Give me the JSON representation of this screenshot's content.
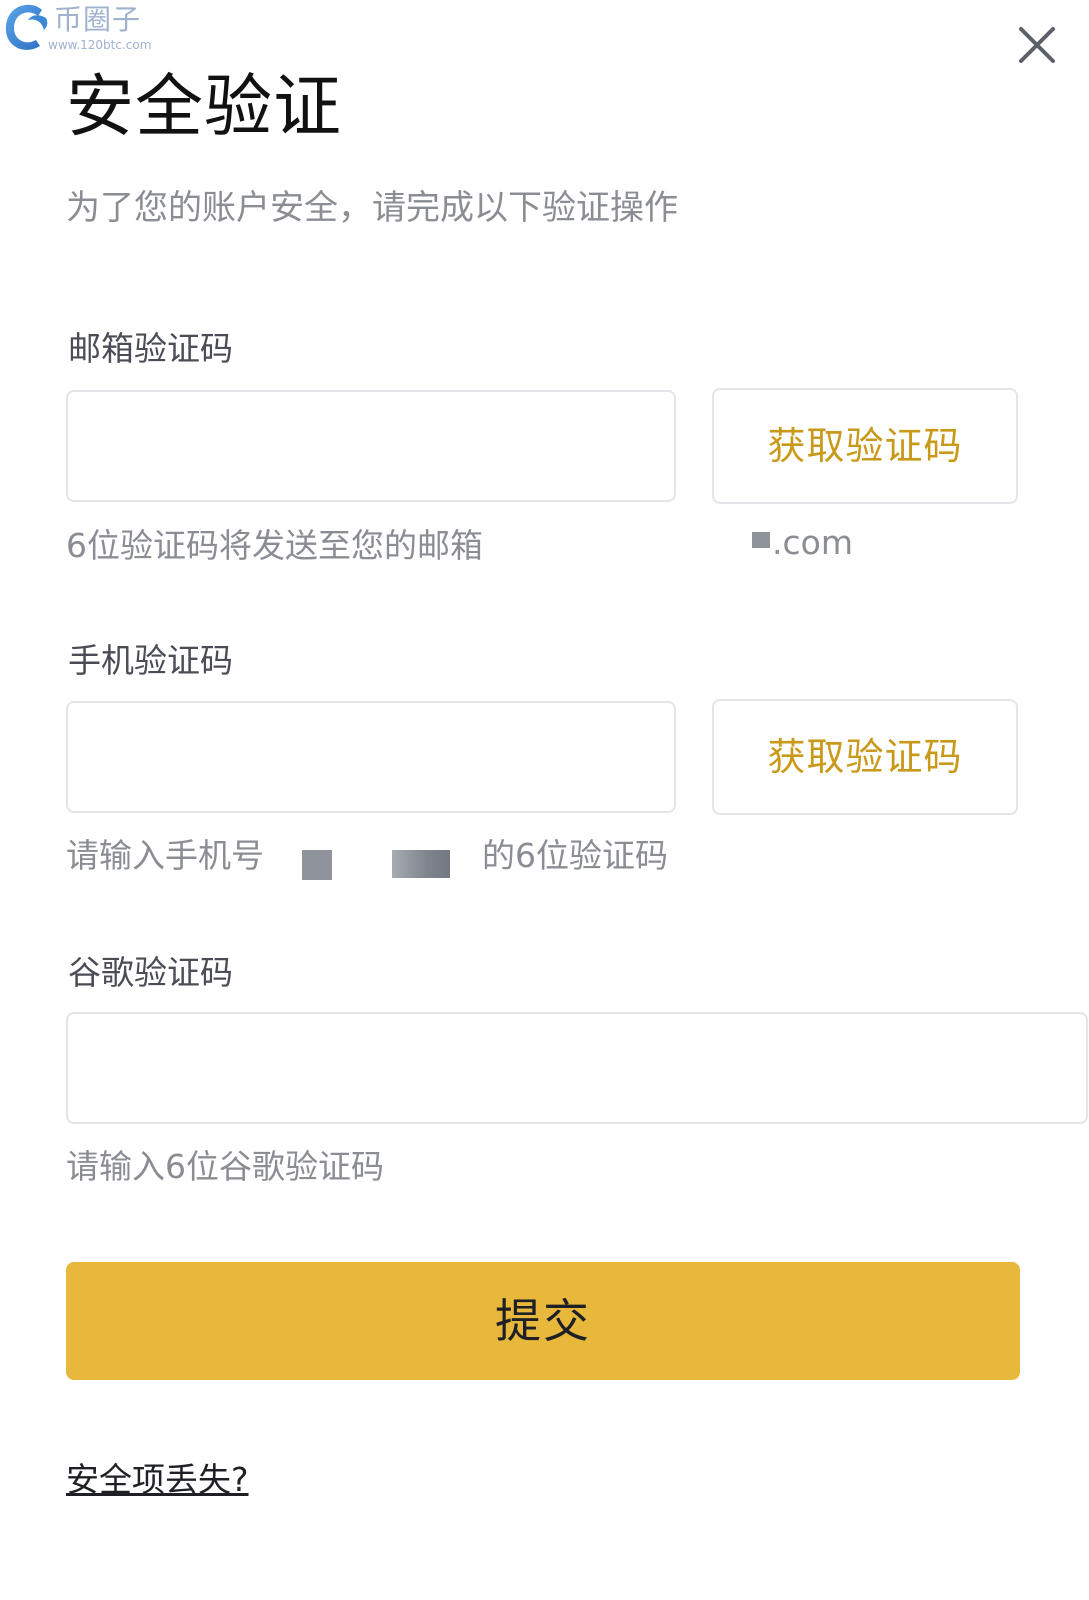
{
  "watermark": {
    "name": "币圈子",
    "url": "www.120btc.com",
    "logo_icon": "c-swirl-logo-icon"
  },
  "dialog": {
    "title": "安全验证",
    "subtitle": "为了您的账户安全，请完成以下验证操作",
    "close_icon": "close-icon"
  },
  "email": {
    "label": "邮箱验证码",
    "value": "",
    "get_code_label": "获取验证码",
    "hint": "6位验证码将发送至您的邮箱",
    "masked_email_suffix": ".com"
  },
  "phone": {
    "label": "手机验证码",
    "value": "",
    "get_code_label": "获取验证码",
    "hint_prefix": "请输入手机号",
    "hint_suffix": "的6位验证码"
  },
  "google": {
    "label": "谷歌验证码",
    "value": "",
    "hint": "请输入6位谷歌验证码"
  },
  "actions": {
    "submit_label": "提交",
    "lost_link": "安全项丢失?"
  },
  "colors": {
    "accent": "#e8b83c",
    "link_accent": "#c99a1a",
    "muted_text": "#8a8d93",
    "border": "#e3e5e8"
  }
}
